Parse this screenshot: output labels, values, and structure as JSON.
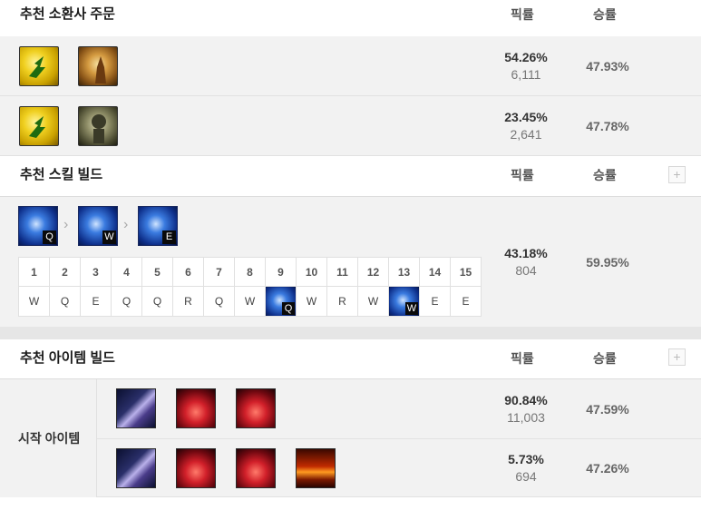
{
  "summoner_section": {
    "title": "추천 소환사 주문",
    "col_pick": "픽률",
    "col_win": "승률",
    "rows": [
      {
        "spells": [
          "flash-icon",
          "ignite-icon"
        ],
        "pick_pct": "54.26%",
        "count": "6,111",
        "win": "47.93%"
      },
      {
        "spells": [
          "flash-icon",
          "exhaust-icon"
        ],
        "pick_pct": "23.45%",
        "count": "2,641",
        "win": "47.78%"
      }
    ]
  },
  "skill_section": {
    "title": "추천 스킬 빌드",
    "col_pick": "픽률",
    "col_win": "승률",
    "plus": "+",
    "order": [
      "Q",
      "W",
      "E"
    ],
    "chevron": "›",
    "levels": [
      "1",
      "2",
      "3",
      "4",
      "5",
      "6",
      "7",
      "8",
      "9",
      "10",
      "11",
      "12",
      "13",
      "14",
      "15"
    ],
    "keys": [
      "W",
      "Q",
      "E",
      "Q",
      "Q",
      "R",
      "Q",
      "W",
      "Q",
      "W",
      "R",
      "W",
      "W",
      "E",
      "E"
    ],
    "highlighted_levels": [
      9,
      13
    ],
    "pick_pct": "43.18%",
    "count": "804",
    "win": "59.95%"
  },
  "item_section": {
    "title": "추천 아이템 빌드",
    "col_pick": "픽률",
    "col_win": "승률",
    "plus": "+",
    "start_label": "시작 아이템",
    "rows": [
      {
        "items": [
          "dagger-icon",
          "potion-icon",
          "potion-icon"
        ],
        "pick_pct": "90.84%",
        "count": "11,003",
        "win": "47.59%"
      },
      {
        "items": [
          "dagger-icon",
          "potion-icon",
          "potion-icon",
          "ward-icon"
        ],
        "pick_pct": "5.73%",
        "count": "694",
        "win": "47.26%"
      }
    ]
  }
}
